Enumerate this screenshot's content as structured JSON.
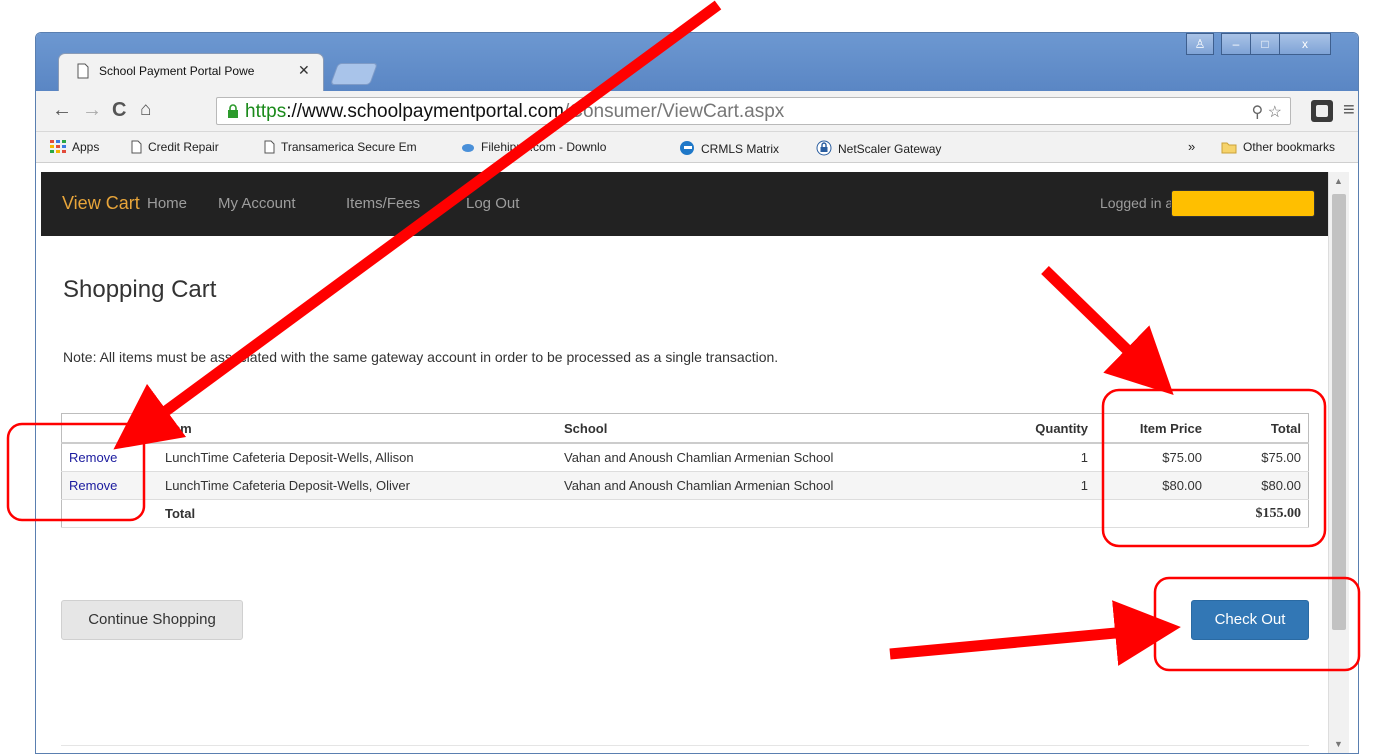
{
  "browser": {
    "tab_title": "School Payment Portal Powe",
    "tab_close": "✕",
    "url_scheme": "https",
    "url_host": "://www.schoolpaymentportal.com",
    "url_path": "/Consumer/ViewCart.aspx",
    "bookmarks": [
      {
        "label": "Apps",
        "icon": "apps-grid-icon"
      },
      {
        "label": "Credit Repair",
        "icon": "page-icon"
      },
      {
        "label": "Transamerica Secure Em",
        "icon": "page-icon"
      },
      {
        "label": "Filehippo.com - Downlo",
        "icon": "filehippo-icon"
      },
      {
        "label": "CRMLS Matrix",
        "icon": "matrix-icon"
      },
      {
        "label": "NetScaler Gateway",
        "icon": "gateway-icon"
      }
    ],
    "bookmarks_more": "»",
    "other_bookmarks": "Other bookmarks"
  },
  "navbar": {
    "brand": "View Cart",
    "links": [
      "Home",
      "My Account",
      "Items/Fees",
      "Log Out"
    ],
    "logged_in": "Logged in as"
  },
  "page": {
    "title": "Shopping Cart",
    "note": "Note: All items must be associated with the same gateway account in order to be processed as a single transaction."
  },
  "cart": {
    "headers": [
      "",
      "Item",
      "School",
      "Quantity",
      "Item Price",
      "Total"
    ],
    "rows": [
      {
        "action": "Remove",
        "item": "LunchTime Cafeteria Deposit-Wells, Allison",
        "school": "Vahan and Anoush Chamlian Armenian School",
        "quantity": "1",
        "price": "$75.00",
        "total": "$75.00"
      },
      {
        "action": "Remove",
        "item": "LunchTime Cafeteria Deposit-Wells, Oliver",
        "school": "Vahan and Anoush Chamlian Armenian School",
        "quantity": "1",
        "price": "$80.00",
        "total": "$80.00"
      }
    ],
    "total_label": "Total",
    "total_value": "$155.00"
  },
  "buttons": {
    "continue": "Continue Shopping",
    "checkout": "Check Out"
  },
  "colors": {
    "navbar_bg": "#222222",
    "brand": "#e8a53a",
    "checkout": "#3277b5",
    "redaction": "#ffbf00",
    "annotation": "#ff0000"
  }
}
